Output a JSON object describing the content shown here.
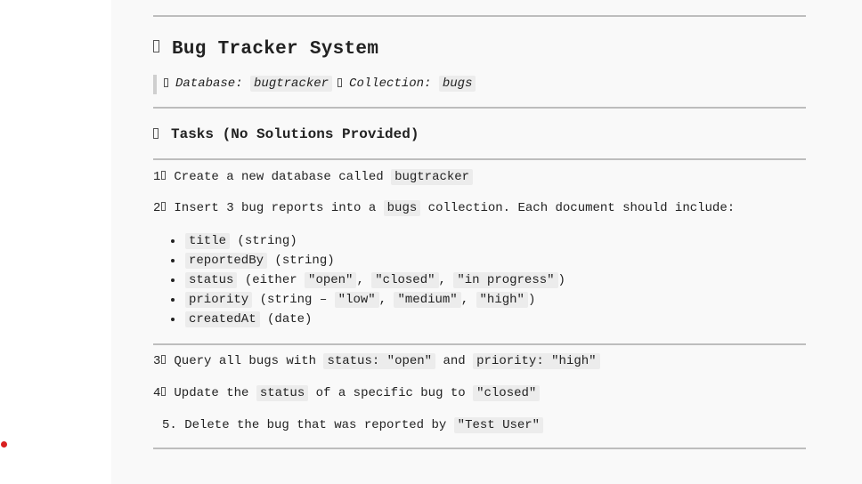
{
  "header": {
    "title": "Bug Tracker System"
  },
  "meta": {
    "database_label": "Database:",
    "database_value": "bugtracker",
    "collection_label": "Collection:",
    "collection_value": "bugs"
  },
  "tasks": {
    "heading": "Tasks (No Solutions Provided)",
    "step1": {
      "number": "1",
      "text": "Create a new database called",
      "code": "bugtracker"
    },
    "step2": {
      "number": "2",
      "text_before": "Insert 3 bug reports into a",
      "code": "bugs",
      "text_after": "collection. Each document should include:"
    },
    "fields": [
      {
        "name": "title",
        "desc": "(string)"
      },
      {
        "name": "reportedBy",
        "desc": "(string)"
      },
      {
        "name": "status",
        "desc_before": "(either",
        "values": [
          "\"open\"",
          "\"closed\"",
          "\"in progress\""
        ],
        "desc_after": ")"
      },
      {
        "name": "priority",
        "desc_before": "(string –",
        "values": [
          "\"low\"",
          "\"medium\"",
          "\"high\""
        ],
        "desc_after": ")"
      },
      {
        "name": "createdAt",
        "desc": "(date)"
      }
    ],
    "step3": {
      "number": "3",
      "text": "Query all bugs with",
      "code1": "status: \"open\"",
      "joiner": "and",
      "code2": "priority: \"high\""
    },
    "step4": {
      "number": "4",
      "text_before": "Update the",
      "code1": "status",
      "text_middle": "of a specific bug to",
      "code2": "\"closed\""
    },
    "step5": {
      "text": "5. Delete the bug that was reported by",
      "code": "\"Test User\""
    }
  },
  "colors": {
    "accent_dot": "#d91f1f",
    "page_bg": "#f9f9f9",
    "rule": "#bdbdbd",
    "code_bg": "#ececec"
  }
}
